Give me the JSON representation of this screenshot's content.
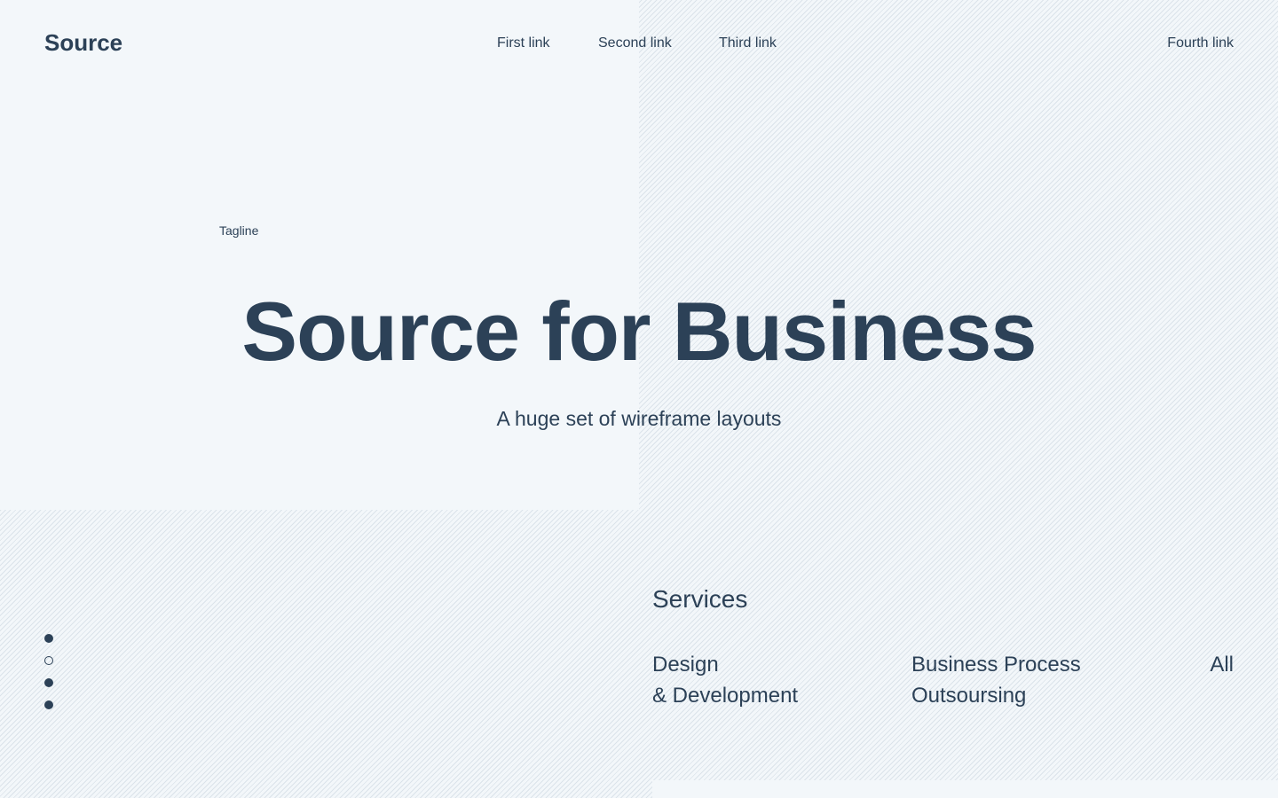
{
  "header": {
    "logo": "Source",
    "nav": {
      "first": "First link",
      "second": "Second link",
      "third": "Third link",
      "fourth": "Fourth link"
    }
  },
  "hero": {
    "tagline": "Tagline",
    "title": "Source for Business",
    "subtitle": "A huge set of wireframe layouts"
  },
  "slider": {
    "dot_count": 4,
    "active_index": 1
  },
  "services": {
    "heading": "Services",
    "items": [
      {
        "line1": "Design",
        "line2": "& Development"
      },
      {
        "line1": "Business Process",
        "line2": "Outsoursing"
      },
      {
        "line1": "All",
        "line2": ""
      }
    ]
  },
  "colors": {
    "text": "#2c4157",
    "background": "#f3f7fa",
    "hatch": "#dbe3ea"
  }
}
